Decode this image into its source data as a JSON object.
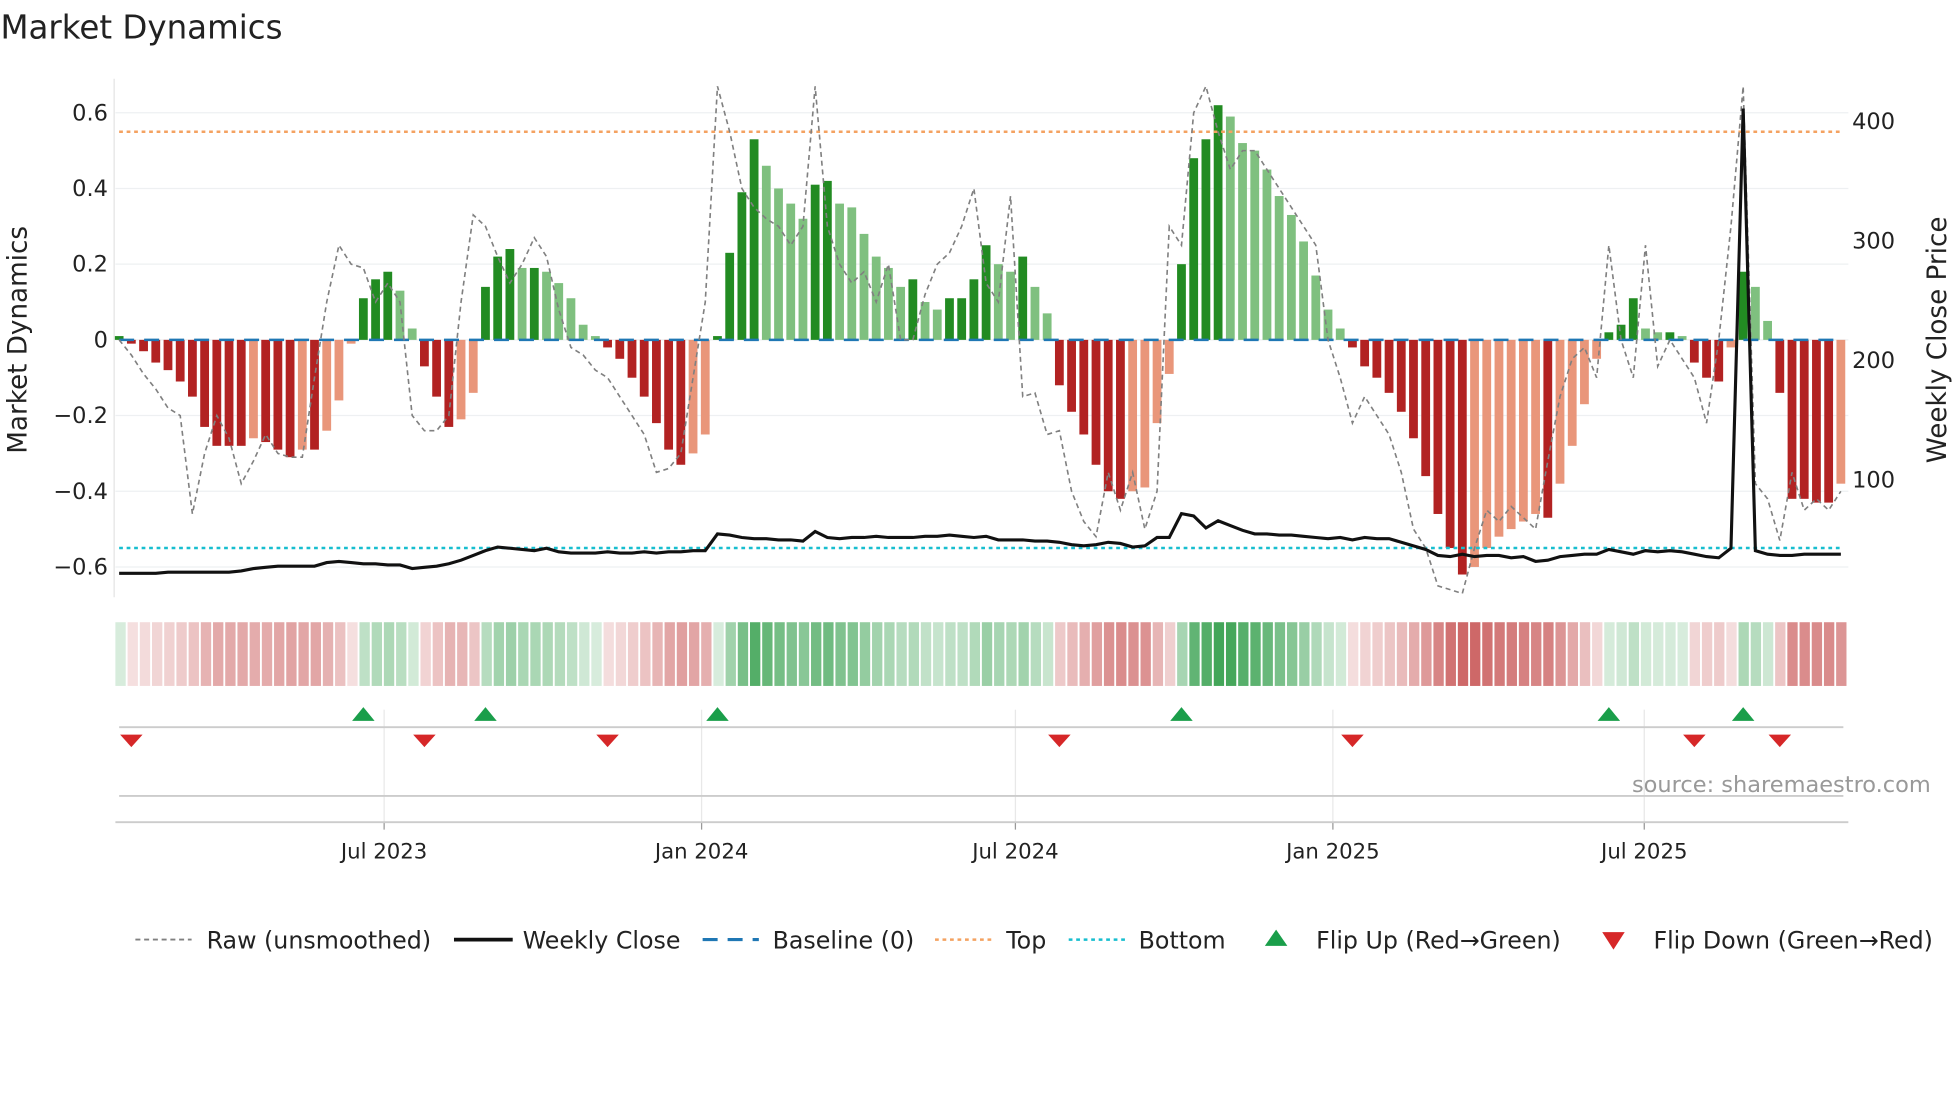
{
  "chart_data": {
    "type": "bar",
    "title": "Market Dynamics",
    "ylabel": "Market Dynamics",
    "y2label": "Weekly Close Price",
    "ylim": [
      -0.68,
      0.69
    ],
    "y2lim": [
      2,
      436
    ],
    "yticks": [
      0.6,
      0.4,
      0.2,
      0,
      -0.2,
      -0.4,
      -0.6
    ],
    "ytick_labels": [
      "0.6",
      "0.4",
      "0.2",
      "0",
      "−0.2",
      "−0.4",
      "−0.6"
    ],
    "y2ticks": [
      400,
      300,
      200,
      100
    ],
    "y2tick_labels": [
      "400",
      "300",
      "200",
      "100"
    ],
    "xticks_week_index": [
      21.7,
      47.7,
      73.4,
      99.4,
      124.9
    ],
    "xtick_labels": [
      "Jul 2023",
      "Jan 2024",
      "Jul 2024",
      "Jan 2025",
      "Jul 2025"
    ],
    "top_level": 0.55,
    "bottom_level": -0.55,
    "baseline": 0,
    "grid": true,
    "legend_placement": "bottom",
    "source": "source: sharemaestro.com",
    "colors": {
      "rising_pos": "#228b22",
      "falling_pos": "#7fc07f",
      "falling_neg": "#b22222",
      "rising_neg": "#e9967a",
      "raw": "#808080",
      "close": "#111111",
      "baseline": "#1f77b4",
      "top": "#f4a261",
      "bottom": "#17becf",
      "flip_up": "#1a9e4a",
      "flip_down": "#d62728"
    },
    "smoothed": [
      0.01,
      -0.01,
      -0.03,
      -0.06,
      -0.08,
      -0.11,
      -0.15,
      -0.23,
      -0.28,
      -0.28,
      -0.28,
      -0.26,
      -0.27,
      -0.29,
      -0.31,
      -0.29,
      -0.29,
      -0.24,
      -0.16,
      -0.01,
      0.11,
      0.16,
      0.18,
      0.13,
      0.03,
      -0.07,
      -0.15,
      -0.23,
      -0.21,
      -0.14,
      0.14,
      0.22,
      0.24,
      0.19,
      0.19,
      0.18,
      0.15,
      0.11,
      0.04,
      0.01,
      -0.02,
      -0.05,
      -0.1,
      -0.15,
      -0.22,
      -0.29,
      -0.33,
      -0.3,
      -0.25,
      0.01,
      0.23,
      0.39,
      0.53,
      0.46,
      0.4,
      0.36,
      0.32,
      0.41,
      0.42,
      0.36,
      0.35,
      0.28,
      0.22,
      0.19,
      0.14,
      0.16,
      0.1,
      0.08,
      0.11,
      0.11,
      0.16,
      0.25,
      0.2,
      0.18,
      0.22,
      0.14,
      0.07,
      -0.12,
      -0.19,
      -0.25,
      -0.33,
      -0.4,
      -0.42,
      -0.4,
      -0.39,
      -0.22,
      -0.09,
      0.2,
      0.48,
      0.53,
      0.62,
      0.59,
      0.52,
      0.5,
      0.45,
      0.38,
      0.33,
      0.26,
      0.17,
      0.08,
      0.03,
      -0.02,
      -0.07,
      -0.1,
      -0.14,
      -0.19,
      -0.26,
      -0.36,
      -0.46,
      -0.55,
      -0.62,
      -0.6,
      -0.55,
      -0.52,
      -0.5,
      -0.48,
      -0.46,
      -0.47,
      -0.38,
      -0.28,
      -0.17,
      -0.05,
      0.02,
      0.04,
      0.11,
      0.03,
      0.02,
      0.02,
      0.01,
      -0.06,
      -0.1,
      -0.11,
      -0.02,
      0.18,
      0.14,
      0.05,
      -0.14,
      -0.42,
      -0.42,
      -0.43,
      -0.43,
      -0.38
    ],
    "raw": [
      0.0,
      -0.04,
      -0.09,
      -0.13,
      -0.18,
      -0.2,
      -0.46,
      -0.3,
      -0.2,
      -0.26,
      -0.38,
      -0.32,
      -0.25,
      -0.3,
      -0.31,
      -0.31,
      -0.1,
      0.1,
      0.25,
      0.2,
      0.19,
      0.1,
      0.15,
      0.1,
      -0.2,
      -0.24,
      -0.24,
      -0.2,
      0.1,
      0.33,
      0.3,
      0.22,
      0.15,
      0.2,
      0.27,
      0.22,
      0.08,
      -0.02,
      -0.04,
      -0.08,
      -0.1,
      -0.15,
      -0.2,
      -0.25,
      -0.35,
      -0.34,
      -0.3,
      -0.1,
      0.1,
      0.67,
      0.55,
      0.4,
      0.35,
      0.32,
      0.3,
      0.25,
      0.3,
      0.67,
      0.3,
      0.2,
      0.15,
      0.18,
      0.1,
      0.2,
      0.0,
      0.0,
      0.12,
      0.2,
      0.23,
      0.3,
      0.4,
      0.15,
      0.1,
      0.38,
      -0.15,
      -0.14,
      -0.25,
      -0.24,
      -0.4,
      -0.48,
      -0.52,
      -0.35,
      -0.45,
      -0.35,
      -0.5,
      -0.4,
      0.3,
      0.25,
      0.6,
      0.67,
      0.55,
      0.45,
      0.5,
      0.5,
      0.45,
      0.4,
      0.35,
      0.3,
      0.25,
      0.0,
      -0.1,
      -0.22,
      -0.15,
      -0.2,
      -0.25,
      -0.35,
      -0.5,
      -0.55,
      -0.65,
      -0.66,
      -0.67,
      -0.55,
      -0.45,
      -0.48,
      -0.44,
      -0.47,
      -0.5,
      -0.32,
      -0.15,
      -0.05,
      -0.02,
      -0.1,
      0.25,
      0.0,
      -0.1,
      0.25,
      -0.07,
      0.0,
      -0.05,
      -0.1,
      -0.22,
      0.0,
      0.3,
      0.67,
      -0.38,
      -0.42,
      -0.53,
      -0.35,
      -0.45,
      -0.42,
      -0.45,
      -0.4
    ],
    "weekly_close": [
      22,
      22,
      22,
      22,
      23,
      23,
      23,
      23,
      23,
      23,
      24,
      26,
      27,
      28,
      28,
      28,
      28,
      31,
      32,
      31,
      30,
      30,
      29,
      29,
      26,
      27,
      28,
      30,
      33,
      37,
      41,
      44,
      43,
      42,
      41,
      43,
      40,
      39,
      39,
      39,
      40,
      39,
      39,
      40,
      39,
      40,
      40,
      41,
      41,
      55,
      54,
      52,
      51,
      51,
      50,
      50,
      49,
      57,
      52,
      51,
      52,
      52,
      53,
      52,
      52,
      52,
      53,
      53,
      54,
      53,
      52,
      53,
      50,
      50,
      50,
      49,
      49,
      48,
      46,
      45,
      46,
      48,
      47,
      44,
      45,
      52,
      52,
      72,
      70,
      60,
      66,
      62,
      58,
      55,
      55,
      54,
      54,
      53,
      52,
      51,
      52,
      50,
      52,
      51,
      51,
      48,
      45,
      42,
      37,
      36,
      38,
      36,
      37,
      37,
      35,
      36,
      32,
      33,
      36,
      37,
      38,
      38,
      42,
      40,
      38,
      41,
      40,
      41,
      40,
      38,
      36,
      35,
      43,
      411,
      41,
      38,
      37,
      37,
      38,
      38,
      38,
      38
    ],
    "flip_up_weeks": [
      20,
      30,
      49,
      87,
      122,
      133
    ],
    "flip_down_weeks": [
      1,
      25,
      40,
      77,
      101,
      129,
      136
    ],
    "legend": [
      {
        "label": "Raw (unsmoothed)",
        "style": "dashed-gray"
      },
      {
        "label": "Weekly Close",
        "style": "solid-black"
      },
      {
        "label": "Baseline (0)",
        "style": "dashed-blue"
      },
      {
        "label": "Top",
        "style": "dotted-orange"
      },
      {
        "label": "Bottom",
        "style": "dotted-cyan"
      },
      {
        "label": "Flip Up (Red→Green)",
        "style": "triangle-up-green"
      },
      {
        "label": "Flip Down (Green→Red)",
        "style": "triangle-down-red"
      }
    ]
  }
}
